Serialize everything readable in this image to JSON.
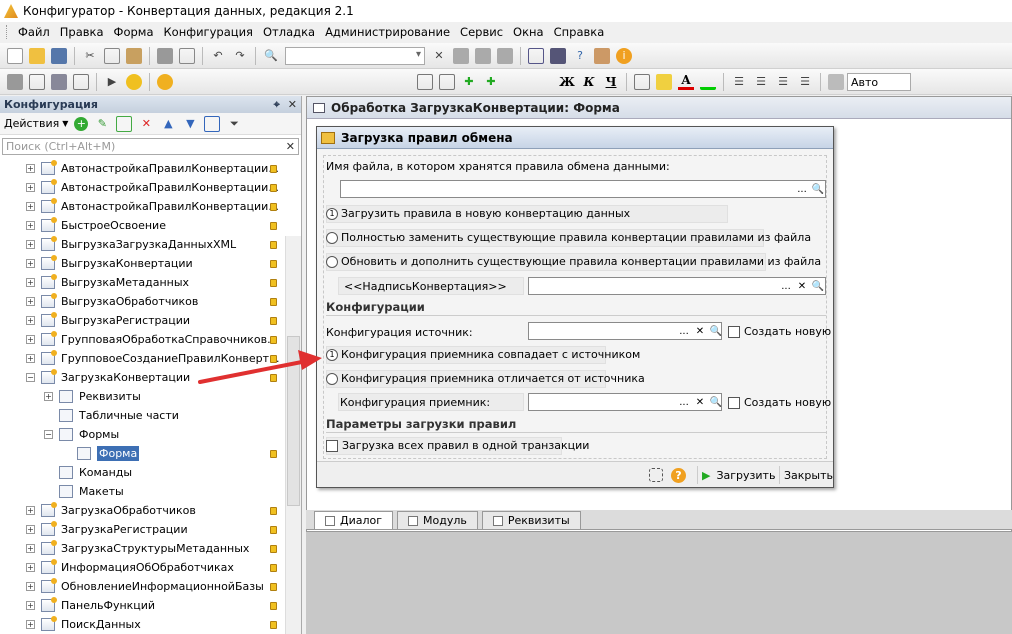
{
  "window": {
    "title": "Конфигуратор - Конвертация данных, редакция 2.1"
  },
  "menu": [
    "Файл",
    "Правка",
    "Форма",
    "Конфигурация",
    "Отладка",
    "Администрирование",
    "Сервис",
    "Окна",
    "Справка"
  ],
  "toolbar2": {
    "font_size": "Авто"
  },
  "left_panel": {
    "title": "Конфигурация",
    "actions_label": "Действия",
    "search_placeholder": "Поиск (Ctrl+Alt+M)",
    "tree": [
      {
        "label": "АвтонастройкаПравилКонвертации...",
        "level": 1,
        "expander": "+"
      },
      {
        "label": "АвтонастройкаПравилКонвертации...",
        "level": 1,
        "expander": "+"
      },
      {
        "label": "АвтонастройкаПравилКонвертации...",
        "level": 1,
        "expander": "+"
      },
      {
        "label": "БыстроеОсвоение",
        "level": 1,
        "expander": "+"
      },
      {
        "label": "ВыгрузкаЗагрузкаДанныхXML",
        "level": 1,
        "expander": "+"
      },
      {
        "label": "ВыгрузкаКонвертации",
        "level": 1,
        "expander": "+"
      },
      {
        "label": "ВыгрузкаМетаданных",
        "level": 1,
        "expander": "+"
      },
      {
        "label": "ВыгрузкаОбработчиков",
        "level": 1,
        "expander": "+"
      },
      {
        "label": "ВыгрузкаРегистрации",
        "level": 1,
        "expander": "+"
      },
      {
        "label": "ГрупповаяОбработкаСправочников...",
        "level": 1,
        "expander": "+"
      },
      {
        "label": "ГрупповоеСозданиеПравилКонверт...",
        "level": 1,
        "expander": "+"
      },
      {
        "label": "ЗагрузкаКонвертации",
        "level": 1,
        "expander": "−"
      },
      {
        "label": "Реквизиты",
        "level": 2,
        "expander": "+"
      },
      {
        "label": "Табличные части",
        "level": 2,
        "expander": ""
      },
      {
        "label": "Формы",
        "level": 2,
        "expander": "−"
      },
      {
        "label": "Форма",
        "level": 3,
        "expander": "",
        "selected": true
      },
      {
        "label": "Команды",
        "level": 2,
        "expander": ""
      },
      {
        "label": "Макеты",
        "level": 2,
        "expander": ""
      },
      {
        "label": "ЗагрузкаОбработчиков",
        "level": 1,
        "expander": "+"
      },
      {
        "label": "ЗагрузкаРегистрации",
        "level": 1,
        "expander": "+"
      },
      {
        "label": "ЗагрузкаСтруктурыМетаданных",
        "level": 1,
        "expander": "+"
      },
      {
        "label": "ИнформацияОбОбработчиках",
        "level": 1,
        "expander": "+"
      },
      {
        "label": "ОбновлениеИнформационнойБазы",
        "level": 1,
        "expander": "+"
      },
      {
        "label": "ПанельФункций",
        "level": 1,
        "expander": "+"
      },
      {
        "label": "ПоискДанных",
        "level": 1,
        "expander": "+"
      }
    ]
  },
  "editor": {
    "title": "Обработка ЗагрузкаКонвертации: Форма",
    "tabs": [
      "Диалог",
      "Модуль",
      "Реквизиты"
    ]
  },
  "form": {
    "title": "Загрузка правил обмена",
    "file_label": "Имя файла, в котором хранятся правила обмена данными:",
    "radio1": "Загрузить правила в новую конвертацию данных",
    "radio1_num": "1",
    "radio2": "Полностью заменить существующие правила конвертации правилами из файла",
    "radio3": "Обновить и дополнить существующие правила конвертации правилами из файла",
    "conv_label": "<<НадписьКонвертация>>",
    "section_configs": "Конфигурации",
    "source_label": "Конфигурация источник:",
    "create_new1": "Создать новую",
    "radio4": "Конфигурация приемника совпадает с источником",
    "radio4_num": "1",
    "radio5": "Конфигурация приемника отличается от источника",
    "target_label": "Конфигурация приемник:",
    "create_new2": "Создать новую",
    "section_params": "Параметры загрузки правил",
    "single_tx": "Загрузка всех правил в одной транзакции",
    "btn_load": "Загрузить",
    "btn_close": "Закрыть",
    "ellipsis": "...",
    "question": "?"
  }
}
